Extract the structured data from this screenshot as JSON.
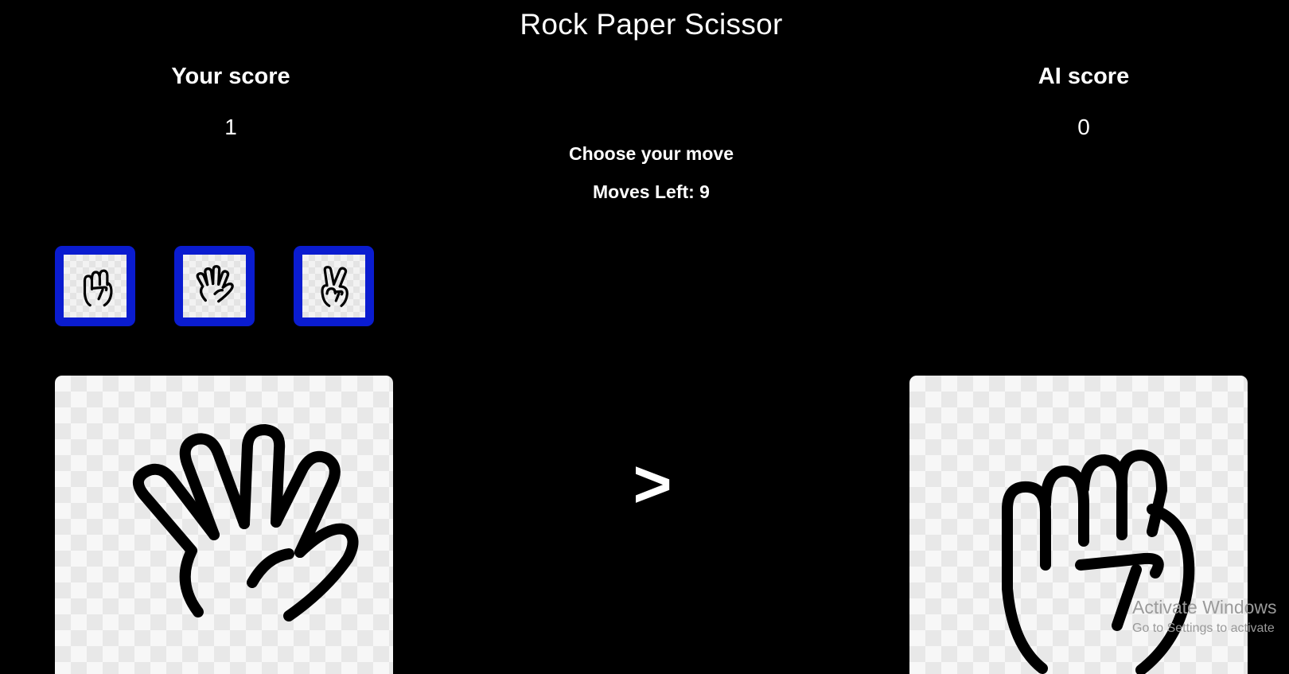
{
  "game": {
    "title": "Rock Paper Scissor",
    "moves_prompt": "Choose your move",
    "moves_left": "Moves Left: 9"
  },
  "scores": {
    "player": {
      "label": "Your score",
      "value": "1"
    },
    "ai": {
      "label": "AI score",
      "value": "0"
    }
  },
  "move_buttons": [
    {
      "move": "rock",
      "icon": "fist-icon"
    },
    {
      "move": "paper",
      "icon": "open-hand-icon"
    },
    {
      "move": "scissors",
      "icon": "victory-hand-icon"
    }
  ],
  "round": {
    "player_choice": "paper",
    "ai_choice": "rock",
    "comparison": ">"
  },
  "colors": {
    "background": "#000000",
    "button_border": "#0a1cd0",
    "text": "#ffffff"
  },
  "os_watermark": {
    "title": "Activate Windows",
    "subtitle": "Go to Settings to activate"
  }
}
